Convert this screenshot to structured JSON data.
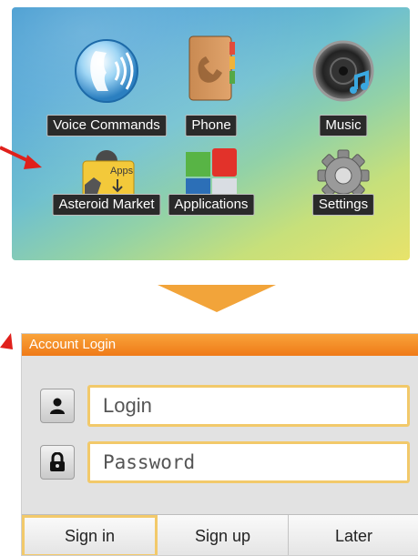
{
  "launcher": {
    "apps": [
      {
        "label": "Voice Commands",
        "icon": "voice-commands-icon"
      },
      {
        "label": "Phone",
        "icon": "phone-book-icon"
      },
      {
        "label": "Music",
        "icon": "speaker-music-icon"
      },
      {
        "label": "Asteroid Market",
        "icon": "asteroid-market-icon",
        "badge": "Apps"
      },
      {
        "label": "Applications",
        "icon": "applications-grid-icon"
      },
      {
        "label": "Settings",
        "icon": "gear-icon"
      }
    ]
  },
  "dialog": {
    "title": "Account Login",
    "login_placeholder": "Login",
    "password_placeholder": "Password",
    "buttons": {
      "sign_in": "Sign in",
      "sign_up": "Sign up",
      "later": "Later"
    }
  },
  "colors": {
    "accent_orange": "#f28a1e",
    "arrow_red": "#e0201b",
    "field_border": "#f2c96a",
    "down_arrow": "#f2a43a"
  }
}
